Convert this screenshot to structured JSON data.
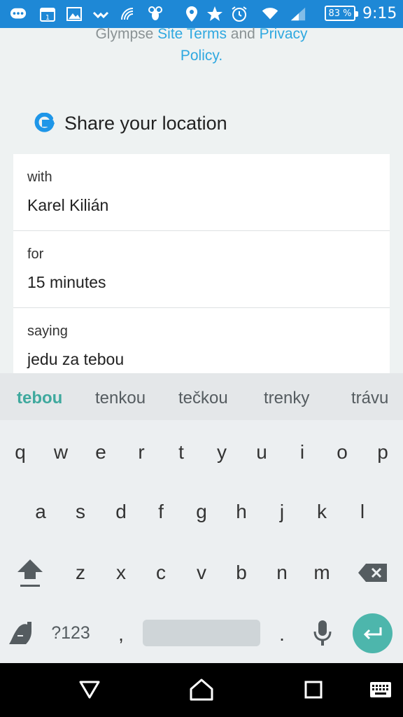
{
  "status_bar": {
    "battery": "83 %",
    "time": "9:15",
    "icons": [
      "chat-icon",
      "calendar-icon",
      "image-icon",
      "wave-icon",
      "nfc-icon",
      "bee-icon",
      "location-icon",
      "star-icon",
      "alarm-icon",
      "wifi-icon",
      "signal-icon"
    ]
  },
  "terms": {
    "line1_prefix": "Glympse ",
    "link1": "Site Terms",
    "middle": " and ",
    "link2a": "Privacy",
    "link2b": "Policy",
    "suffix": "."
  },
  "share": {
    "title": "Share your location",
    "rows": [
      {
        "label": "with",
        "value": "Karel Kilián"
      },
      {
        "label": "for",
        "value": "15 minutes"
      },
      {
        "label": "saying",
        "value": "jedu za tebou"
      }
    ]
  },
  "keyboard": {
    "suggestions": [
      "tebou",
      "tenkou",
      "tečkou",
      "trenky",
      "trávu"
    ],
    "row1": [
      "q",
      "w",
      "e",
      "r",
      "t",
      "y",
      "u",
      "i",
      "o",
      "p"
    ],
    "row2": [
      "a",
      "s",
      "d",
      "f",
      "g",
      "h",
      "j",
      "k",
      "l"
    ],
    "row3": [
      "z",
      "x",
      "c",
      "v",
      "b",
      "n",
      "m"
    ],
    "symbols_label": "?123",
    "comma": ",",
    "period": "."
  },
  "colors": {
    "status_bar": "#1e88d6",
    "accent": "#4db6ac",
    "link": "#2fa8e0"
  }
}
